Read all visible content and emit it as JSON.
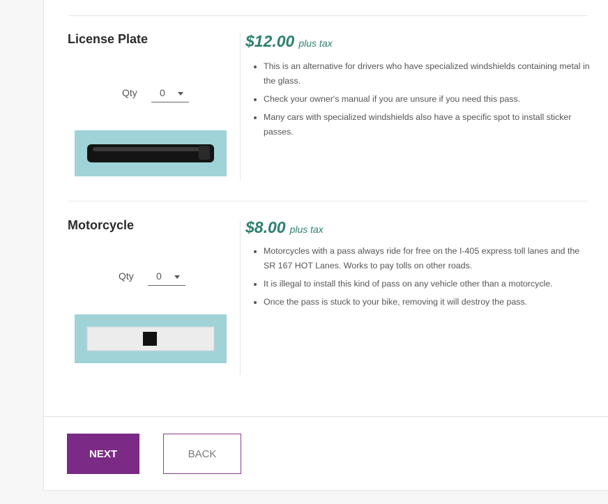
{
  "products": [
    {
      "name": "License Plate",
      "qty_label": "Qty",
      "qty_value": "0",
      "price": "$12.00",
      "price_suffix": "plus tax",
      "bullets": [
        "This is an alternative for drivers who have specialized windshields containing metal in the glass.",
        "Check your owner's manual if you are unsure if you need this pass.",
        "Many cars with specialized windshields also have a specific spot to install sticker passes."
      ],
      "image_background": "#9fd3d8"
    },
    {
      "name": "Motorcycle",
      "qty_label": "Qty",
      "qty_value": "0",
      "price": "$8.00",
      "price_suffix": "plus tax",
      "bullets": [
        "Motorcycles with a pass always ride for free on the I-405 express toll lanes and the SR 167 HOT Lanes. Works to pay tolls on other roads.",
        "It is illegal to install this kind of pass on any vehicle other than a motorcycle.",
        "Once the pass is stuck to your bike, removing it will destroy the pass."
      ],
      "image_background": "#9fd3d8"
    }
  ],
  "buttons": {
    "next_label": "NEXT",
    "back_label": "BACK"
  },
  "colors": {
    "accent": "#7b2a86",
    "price": "#2e8070",
    "image_bg": "#9fd3d8"
  }
}
